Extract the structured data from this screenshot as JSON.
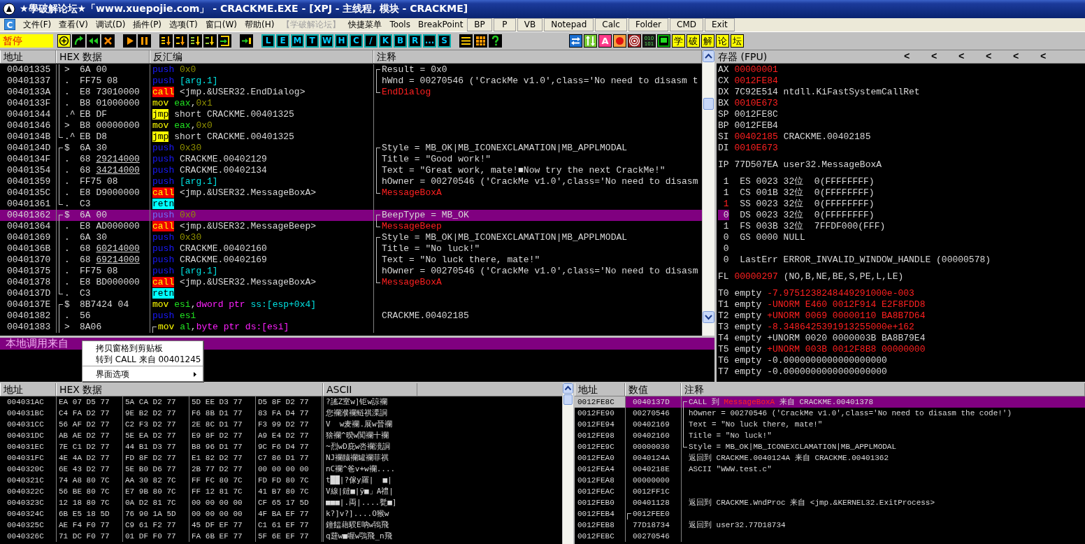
{
  "window": {
    "title": "★學破解论坛★「www.xuepojie.com」 - CRACKME.EXE - [XPJ - 主线程, 模块 - CRACKME]"
  },
  "menu_logo": "C",
  "menu": [
    {
      "label": "文件(F)",
      "kind": "menu",
      "disabled": false
    },
    {
      "label": "查看(V)",
      "kind": "menu",
      "disabled": false
    },
    {
      "label": "调试(D)",
      "kind": "menu",
      "disabled": false
    },
    {
      "label": "插件(P)",
      "kind": "menu",
      "disabled": false
    },
    {
      "label": "选项(T)",
      "kind": "menu",
      "disabled": false
    },
    {
      "label": "窗口(W)",
      "kind": "menu",
      "disabled": false
    },
    {
      "label": "帮助(H)",
      "kind": "menu",
      "disabled": false
    },
    {
      "label": "【学破解论坛】",
      "kind": "menu",
      "disabled": true
    },
    {
      "label": "快捷菜单",
      "kind": "menu",
      "disabled": false
    },
    {
      "label": "Tools",
      "kind": "menu",
      "disabled": false
    },
    {
      "label": "BreakPoint",
      "kind": "menu",
      "disabled": false
    },
    {
      "label": "BP",
      "kind": "button",
      "disabled": false
    },
    {
      "label": "P",
      "kind": "button",
      "disabled": false
    },
    {
      "label": "VB",
      "kind": "button",
      "disabled": false
    },
    {
      "label": "Notepad",
      "kind": "button",
      "disabled": false
    },
    {
      "label": "Calc",
      "kind": "button",
      "disabled": false
    },
    {
      "label": "Folder",
      "kind": "button",
      "disabled": false
    },
    {
      "label": "CMD",
      "kind": "button",
      "disabled": false
    },
    {
      "label": "Exit",
      "kind": "button",
      "disabled": false
    }
  ],
  "toolbar": {
    "status": "暂停",
    "groups": [
      {
        "items": [
          {
            "kind": "icon"
          },
          {
            "kind": "icon"
          },
          {
            "kind": "icon"
          },
          {
            "kind": "icon"
          }
        ]
      },
      {
        "items": [
          {
            "kind": "icon"
          },
          {
            "kind": "icon"
          }
        ]
      },
      {
        "items": [
          {
            "kind": "icon"
          },
          {
            "kind": "icon"
          },
          {
            "kind": "icon"
          },
          {
            "kind": "icon"
          },
          {
            "kind": "icon"
          }
        ]
      },
      {
        "items": [
          {
            "kind": "icon"
          }
        ]
      },
      {
        "items": [
          {
            "kind": "letter",
            "label": "L"
          },
          {
            "kind": "letter",
            "label": "E"
          },
          {
            "kind": "letter",
            "label": "M"
          },
          {
            "kind": "letter",
            "label": "T"
          },
          {
            "kind": "letter",
            "label": "W"
          },
          {
            "kind": "letter",
            "label": "H"
          },
          {
            "kind": "letter",
            "label": "C"
          },
          {
            "kind": "letter",
            "label": "/"
          },
          {
            "kind": "letter",
            "label": "K"
          },
          {
            "kind": "letter",
            "label": "B"
          },
          {
            "kind": "letter",
            "label": "R"
          },
          {
            "kind": "letter",
            "label": "..."
          },
          {
            "kind": "letter",
            "label": "S"
          }
        ]
      },
      {
        "items": [
          {
            "kind": "icon"
          },
          {
            "kind": "icon"
          },
          {
            "kind": "icon"
          }
        ]
      },
      {
        "items": [
          {
            "kind": "icon"
          },
          {
            "kind": "icon"
          },
          {
            "kind": "badge",
            "label": "A"
          },
          {
            "kind": "icon"
          },
          {
            "kind": "icon"
          },
          {
            "kind": "digits",
            "label": "010 101"
          },
          {
            "kind": "icon"
          },
          {
            "kind": "han",
            "label": "学"
          },
          {
            "kind": "han",
            "label": "破"
          },
          {
            "kind": "han",
            "label": "解"
          },
          {
            "kind": "han",
            "label": "论"
          },
          {
            "kind": "han",
            "label": "坛"
          }
        ]
      }
    ]
  },
  "disasm": {
    "columns": [
      "地址",
      "HEX 数据",
      "反汇编",
      "注释"
    ],
    "rows": [
      {
        "address": "00401335",
        "bracket": {
          "kind": "mid"
        },
        "mark": ">",
        "hex": "6A 00",
        "instruction": [
          {
            "text": "push ",
            "kind": "push"
          },
          {
            "text": "0x0",
            "kind": "imm"
          }
        ],
        "comment_bracket": {
          "kind": "top"
        },
        "comment": [
          {
            "text": "Result = 0x0",
            "kind": "plain"
          }
        ],
        "selected": false
      },
      {
        "address": "00401337",
        "bracket": {
          "kind": "mid"
        },
        "mark": ".",
        "hex": "FF75 08",
        "instruction": [
          {
            "text": "push ",
            "kind": "push"
          },
          {
            "text": "[arg.1]",
            "kind": "arg"
          }
        ],
        "comment_bracket": {
          "kind": "mid"
        },
        "comment": [
          {
            "text": "hWnd = 00270546 ('CrackMe v1.0',class='No need to disasm t",
            "kind": "plain"
          }
        ],
        "selected": false
      },
      {
        "address": "0040133A",
        "bracket": {
          "kind": "mid"
        },
        "mark": ".",
        "hex": "E8 73010000",
        "instruction": [
          {
            "text": "call",
            "kind": "call"
          },
          {
            "text": " <jmp.&USER32.EndDialog>",
            "kind": "plain"
          }
        ],
        "comment_bracket": {
          "kind": "bottom"
        },
        "comment": [
          {
            "text": "EndDialog",
            "kind": "api"
          }
        ],
        "selected": false
      },
      {
        "address": "0040133F",
        "bracket": {
          "kind": "mid"
        },
        "mark": ".",
        "hex": "B8 01000000",
        "instruction": [
          {
            "text": "mov ",
            "kind": "mov"
          },
          {
            "text": "eax",
            "kind": "reg"
          },
          {
            "text": ",",
            "kind": "plain"
          },
          {
            "text": "0x1",
            "kind": "imm"
          }
        ],
        "selected": false
      },
      {
        "address": "00401344",
        "bracket": {
          "kind": "mid"
        },
        "mark": ".^",
        "hex": "EB DF",
        "instruction": [
          {
            "text": "jmp",
            "kind": "jmp"
          },
          {
            "text": " short CRACKME.00401325",
            "kind": "plain"
          }
        ],
        "selected": false
      },
      {
        "address": "00401346",
        "bracket": {
          "kind": "mid"
        },
        "mark": ">",
        "hex": "B8 00000000",
        "instruction": [
          {
            "text": "mov ",
            "kind": "mov"
          },
          {
            "text": "eax",
            "kind": "reg"
          },
          {
            "text": ",",
            "kind": "plain"
          },
          {
            "text": "0x0",
            "kind": "imm"
          }
        ],
        "selected": false
      },
      {
        "address": "0040134B",
        "bracket": {
          "kind": "bottom"
        },
        "mark": ".^",
        "hex": "EB D8",
        "instruction": [
          {
            "text": "jmp",
            "kind": "jmp"
          },
          {
            "text": " short CRACKME.00401325",
            "kind": "plain"
          }
        ],
        "selected": false
      },
      {
        "address": "0040134D",
        "bracket": {
          "kind": "top"
        },
        "mark": "$",
        "hex": "6A 30",
        "instruction": [
          {
            "text": "push ",
            "kind": "push"
          },
          {
            "text": "0x30",
            "kind": "imm"
          }
        ],
        "comment_bracket": {
          "kind": "top"
        },
        "comment": [
          {
            "text": "Style = MB_OK|MB_ICONEXCLAMATION|MB_APPLMODAL",
            "kind": "plain"
          }
        ],
        "selected": false
      },
      {
        "address": "0040134F",
        "bracket": {
          "kind": "mid"
        },
        "mark": ".",
        "hex": "68",
        "hex_ref": "29214000",
        "instruction": [
          {
            "text": "push ",
            "kind": "push"
          },
          {
            "text": "CRACKME.00402129",
            "kind": "plain"
          }
        ],
        "comment_bracket": {
          "kind": "mid"
        },
        "comment": [
          {
            "text": "Title = \"Good work!\"",
            "kind": "plain"
          }
        ],
        "selected": false
      },
      {
        "address": "00401354",
        "bracket": {
          "kind": "mid"
        },
        "mark": ".",
        "hex": "68",
        "hex_ref": "34214000",
        "instruction": [
          {
            "text": "push ",
            "kind": "push"
          },
          {
            "text": "CRACKME.00402134",
            "kind": "plain"
          }
        ],
        "comment_bracket": {
          "kind": "mid"
        },
        "comment": [
          {
            "text": "Text = \"Great work, mate!■Now try the next CrackMe!\"",
            "kind": "plain"
          }
        ],
        "selected": false
      },
      {
        "address": "00401359",
        "bracket": {
          "kind": "mid"
        },
        "mark": ".",
        "hex": "FF75 08",
        "instruction": [
          {
            "text": "push ",
            "kind": "push"
          },
          {
            "text": "[arg.1]",
            "kind": "arg"
          }
        ],
        "comment_bracket": {
          "kind": "mid"
        },
        "comment": [
          {
            "text": "hOwner = 00270546 ('CrackMe v1.0',class='No need to disasm",
            "kind": "plain"
          }
        ],
        "selected": false
      },
      {
        "address": "0040135C",
        "bracket": {
          "kind": "mid"
        },
        "mark": ".",
        "hex": "E8 D9000000",
        "instruction": [
          {
            "text": "call",
            "kind": "call"
          },
          {
            "text": " <jmp.&USER32.MessageBoxA>",
            "kind": "plain"
          }
        ],
        "comment_bracket": {
          "kind": "bottom"
        },
        "comment": [
          {
            "text": "MessageBoxA",
            "kind": "api"
          }
        ],
        "selected": false
      },
      {
        "address": "00401361",
        "bracket": {
          "kind": "bottom"
        },
        "mark": ".",
        "hex": "C3",
        "instruction": [
          {
            "text": "retn",
            "kind": "retn"
          }
        ],
        "selected": false
      },
      {
        "address": "00401362",
        "bracket": {
          "kind": "top"
        },
        "mark": "$",
        "hex": "6A 00",
        "instruction": [
          {
            "text": "push ",
            "kind": "push"
          },
          {
            "text": "0x0",
            "kind": "imm"
          }
        ],
        "comment_bracket": {
          "kind": "top"
        },
        "comment": [
          {
            "text": "BeepType = MB_OK",
            "kind": "plain"
          }
        ],
        "selected": true
      },
      {
        "address": "00401364",
        "bracket": {
          "kind": "mid"
        },
        "mark": ".",
        "hex": "E8 AD000000",
        "instruction": [
          {
            "text": "call",
            "kind": "call"
          },
          {
            "text": " <jmp.&USER32.MessageBeep>",
            "kind": "plain"
          }
        ],
        "comment_bracket": {
          "kind": "bottom"
        },
        "comment": [
          {
            "text": "MessageBeep",
            "kind": "api"
          }
        ],
        "selected": false
      },
      {
        "address": "00401369",
        "bracket": {
          "kind": "mid"
        },
        "mark": ".",
        "hex": "6A 30",
        "instruction": [
          {
            "text": "push ",
            "kind": "push"
          },
          {
            "text": "0x30",
            "kind": "imm"
          }
        ],
        "comment_bracket": {
          "kind": "top"
        },
        "comment": [
          {
            "text": "Style = MB_OK|MB_ICONEXCLAMATION|MB_APPLMODAL",
            "kind": "plain"
          }
        ],
        "selected": false
      },
      {
        "address": "0040136B",
        "bracket": {
          "kind": "mid"
        },
        "mark": ".",
        "hex": "68",
        "hex_ref": "60214000",
        "instruction": [
          {
            "text": "push ",
            "kind": "push"
          },
          {
            "text": "CRACKME.00402160",
            "kind": "plain"
          }
        ],
        "comment_bracket": {
          "kind": "mid"
        },
        "comment": [
          {
            "text": "Title = \"No luck!\"",
            "kind": "plain"
          }
        ],
        "selected": false
      },
      {
        "address": "00401370",
        "bracket": {
          "kind": "mid"
        },
        "mark": ".",
        "hex": "68",
        "hex_ref": "69214000",
        "instruction": [
          {
            "text": "push ",
            "kind": "push"
          },
          {
            "text": "CRACKME.00402169",
            "kind": "plain"
          }
        ],
        "comment_bracket": {
          "kind": "mid"
        },
        "comment": [
          {
            "text": "Text = \"No luck there, mate!\"",
            "kind": "plain"
          }
        ],
        "selected": false
      },
      {
        "address": "00401375",
        "bracket": {
          "kind": "mid"
        },
        "mark": ".",
        "hex": "FF75 08",
        "instruction": [
          {
            "text": "push ",
            "kind": "push"
          },
          {
            "text": "[arg.1]",
            "kind": "arg"
          }
        ],
        "comment_bracket": {
          "kind": "mid"
        },
        "comment": [
          {
            "text": "hOwner = 00270546 ('CrackMe v1.0',class='No need to disasm",
            "kind": "plain"
          }
        ],
        "selected": false
      },
      {
        "address": "00401378",
        "bracket": {
          "kind": "mid"
        },
        "mark": ".",
        "hex": "E8 BD000000",
        "instruction": [
          {
            "text": "call",
            "kind": "call"
          },
          {
            "text": " <jmp.&USER32.MessageBoxA>",
            "kind": "plain"
          }
        ],
        "comment_bracket": {
          "kind": "bottom"
        },
        "comment": [
          {
            "text": "MessageBoxA",
            "kind": "api"
          }
        ],
        "selected": false
      },
      {
        "address": "0040137D",
        "bracket": {
          "kind": "bottom"
        },
        "mark": ".",
        "hex": "C3",
        "instruction": [
          {
            "text": "retn",
            "kind": "retn"
          }
        ],
        "selected": false
      },
      {
        "address": "0040137E",
        "bracket": {
          "kind": "top"
        },
        "mark": "$",
        "hex": "8B7424 04",
        "instruction": [
          {
            "text": "mov ",
            "kind": "mov"
          },
          {
            "text": "esi",
            "kind": "reg"
          },
          {
            "text": ",",
            "kind": "plain"
          },
          {
            "text": "dword ptr ",
            "kind": "ptr"
          },
          {
            "text": "ss:[esp+0x4]",
            "kind": "mem"
          }
        ],
        "selected": false
      },
      {
        "address": "00401382",
        "bracket": {
          "kind": "mid"
        },
        "mark": ".",
        "hex": "56",
        "instruction": [
          {
            "text": "push ",
            "kind": "push"
          },
          {
            "text": "esi",
            "kind": "reg"
          }
        ],
        "comment": [
          {
            "text": "CRACKME.00402185",
            "kind": "plain"
          }
        ],
        "selected": false
      },
      {
        "address": "00401383",
        "bracket": {
          "kind": "mid"
        },
        "mark": ">",
        "hex": "8A06",
        "instruction_bracket": {
          "kind": "top"
        },
        "instruction": [
          {
            "text": "mov ",
            "kind": "mov"
          },
          {
            "text": "al",
            "kind": "reg"
          },
          {
            "text": ",",
            "kind": "plain"
          },
          {
            "text": "byte ptr ds:[esi]",
            "kind": "ptr"
          }
        ],
        "selected": false
      }
    ]
  },
  "info": {
    "text": "本地调用来自"
  },
  "context_menu": [
    {
      "label": "拷贝窗格到剪贴板",
      "submenu": false,
      "separator_after": false
    },
    {
      "label": "转到 CALL 来自 00401245",
      "submenu": false,
      "separator_after": true
    },
    {
      "label": "界面选项",
      "submenu": true,
      "separator_after": false
    }
  ],
  "registers": {
    "title": "存器 (FPU)",
    "arrows": [
      "<",
      "<",
      "<",
      "<",
      "<",
      "<"
    ],
    "groups": [
      [
        [
          {
            "text": "AX ",
            "kind": "plain"
          },
          {
            "text": "00000001",
            "kind": "changed"
          }
        ],
        [
          {
            "text": "CX ",
            "kind": "plain"
          },
          {
            "text": "0012FE84",
            "kind": "changed"
          }
        ],
        [
          {
            "text": "DX 7C92E514 ntdll.KiFastSystemCallRet",
            "kind": "plain"
          }
        ],
        [
          {
            "text": "BX ",
            "kind": "plain"
          },
          {
            "text": "0010E673",
            "kind": "changed"
          }
        ],
        [
          {
            "text": "SP 0012FE8C",
            "kind": "plain"
          }
        ],
        [
          {
            "text": "BP 0012FEB4",
            "kind": "plain"
          }
        ],
        [
          {
            "text": "SI ",
            "kind": "plain"
          },
          {
            "text": "00402185",
            "kind": "changed"
          },
          {
            "text": " CRACKME.00402185",
            "kind": "plain"
          }
        ],
        [
          {
            "text": "DI ",
            "kind": "plain"
          },
          {
            "text": "0010E673",
            "kind": "changed"
          }
        ]
      ],
      [
        [
          {
            "text": "IP 77D507EA user32.MessageBoxA",
            "kind": "plain"
          }
        ]
      ],
      [
        [
          {
            "text": " 1",
            "kind": "plain"
          },
          {
            "text": "  ES 0023 32位  0(FFFFFFFF)",
            "kind": "plain"
          }
        ],
        [
          {
            "text": " 1",
            "kind": "plain"
          },
          {
            "text": "  CS 001B 32位  0(FFFFFFFF)",
            "kind": "plain"
          }
        ],
        [
          {
            "text": " 1",
            "kind": "changed"
          },
          {
            "text": "  SS 0023 32位  0(FFFFFFFF)",
            "kind": "plain"
          }
        ],
        [
          {
            "text": " 0",
            "kind": "selected"
          },
          {
            "text": "  DS 0023 32位  0(FFFFFFFF)",
            "kind": "plain"
          }
        ],
        [
          {
            "text": " 1",
            "kind": "plain"
          },
          {
            "text": "  FS 003B 32位  7FFDF000(FFF)",
            "kind": "plain"
          }
        ],
        [
          {
            "text": " 0",
            "kind": "plain"
          },
          {
            "text": "  GS 0000 NULL",
            "kind": "plain"
          }
        ],
        [
          {
            "text": " 0",
            "kind": "plain"
          }
        ],
        [
          {
            "text": " 0",
            "kind": "plain"
          },
          {
            "text": "  LastErr ERROR_INVALID_WINDOW_HANDLE (00000578)",
            "kind": "plain"
          }
        ]
      ],
      [
        [
          {
            "text": "FL ",
            "kind": "plain"
          },
          {
            "text": "00000297",
            "kind": "changed"
          },
          {
            "text": " (NO,B,NE,BE,S,PE,L,LE)",
            "kind": "plain"
          }
        ]
      ],
      [
        [
          {
            "text": "T0 empty ",
            "kind": "plain"
          },
          {
            "text": "-7.9751238248449291000e-003",
            "kind": "changed"
          }
        ],
        [
          {
            "text": "T1 empty ",
            "kind": "plain"
          },
          {
            "text": "-UNORM E460 0012F914 E2F8FDD8",
            "kind": "changed"
          }
        ],
        [
          {
            "text": "T2 empty ",
            "kind": "plain"
          },
          {
            "text": "+UNORM 0069 00000110 BA8B7D64",
            "kind": "changed"
          }
        ],
        [
          {
            "text": "T3 empty ",
            "kind": "plain"
          },
          {
            "text": "-8.3486425391913255000e+162",
            "kind": "changed"
          }
        ],
        [
          {
            "text": "T4 empty +UNORM 0020 0000003B BA8B79E4",
            "kind": "plain"
          }
        ],
        [
          {
            "text": "T5 empty ",
            "kind": "plain"
          },
          {
            "text": "+UNORM 003B 0012F8B8 00000000",
            "kind": "changed"
          }
        ],
        [
          {
            "text": "T6 empty -0.0000000000000000000",
            "kind": "plain"
          }
        ],
        [
          {
            "text": "T7 empty -0.0000000000000000000",
            "kind": "plain"
          }
        ]
      ]
    ]
  },
  "dump": {
    "columns": [
      "地址",
      "HEX 数据",
      "ASCII"
    ],
    "rows": [
      {
        "address": "004031AC",
        "hex": [
          "EA 07 D5 77",
          "5A CA D2 77",
          "5D EE D3 77",
          "D5 8F D2 77"
        ],
        "ascii": "?謠Z室w]钜w諒襴"
      },
      {
        "address": "004031BC",
        "hex": [
          "C4 FA D2 77",
          "9E B2 D2 77",
          "F6 8B D1 77",
          "83 FA D4 77"
        ],
        "ascii": "您襴濮襴鲢祺溧詷"
      },
      {
        "address": "004031CC",
        "hex": [
          "56 AF D2 77",
          "C2 F3 D2 77",
          "2E 8C D1 77",
          "F3 99 D2 77"
        ],
        "ascii": "V  w麦襴.展w晉襴"
      },
      {
        "address": "004031DC",
        "hex": [
          "AB AE D2 77",
          "5E EA D2 77",
          "E9 8F D2 77",
          "A9 E4 D2 77"
        ],
        "ascii": "猞襴^暌w闃襴十襴"
      },
      {
        "address": "004031EC",
        "hex": [
          "7E C1 D2 77",
          "44 B1 D3 77",
          "B8 96 D1 77",
          "9C F6 D4 77"
        ],
        "ascii": "~烈wD庇w呇襴滰詷"
      },
      {
        "address": "004031FC",
        "hex": [
          "4E 4A D2 77",
          "FD 8F D2 77",
          "E1 82 D2 77",
          "C7 86 D1 77"
        ],
        "ascii": "NJ襴齉襴罐襴菲祺"
      },
      {
        "address": "0040320C",
        "hex": [
          "6E 43 D2 77",
          "5E B0 D6 77",
          "2B 77 D2 77",
          "00 00 00 00"
        ],
        "ascii": "nC襴^爸v+w襴...."
      },
      {
        "address": "0040321C",
        "hex": [
          "74 A8 80 7C",
          "AA 30 82 7C",
          "FF FC 80 7C",
          "FD FD 80 7C"
        ],
        "ascii": "t██|?傢y羅|  ■|"
      },
      {
        "address": "0040322C",
        "hex": [
          "56 BE 80 7C",
          "E7 9B 80 7C",
          "FF 12 81 7C",
          "41 B7 80 7C"
        ],
        "ascii": "V線|鐽■|ÿ■」A禮|"
      },
      {
        "address": "0040323C",
        "hex": [
          "12 18 80 7C",
          "0A D2 81 7C",
          "00 00 00 00",
          "CF 65 17 5D"
        ],
        "ascii": "■■■|.両|....甏■]"
      },
      {
        "address": "0040324C",
        "hex": [
          "6B E5 18 5D",
          "76 90 1A 5D",
          "00 00 00 00",
          "4F BA EF 77"
        ],
        "ascii": "k?]v?]....O猴w"
      },
      {
        "address": "0040325C",
        "hex": [
          "AE F4 F0 77",
          "C9 61 F2 77",
          "45 DF EF 77",
          "C1 61 EF 77"
        ],
        "ascii": "鐘饂藉騤E呐w鴇飛"
      },
      {
        "address": "0040326C",
        "hex": [
          "71 DC F0 77",
          "01 DF F0 77",
          "FA 6B EF 77",
          "5F 6E EF 77"
        ],
        "ascii": "q莛w■喔w鶚飛_n飛"
      }
    ]
  },
  "stack": {
    "columns": [
      "地址",
      "数值",
      "注释"
    ],
    "rows": [
      {
        "address": "0012FE8C",
        "value": "0040137D",
        "comment_bracket": {
          "kind": "top"
        },
        "comment": [
          {
            "text": "CALL 到 ",
            "kind": "plain"
          },
          {
            "text": "MessageBoxA",
            "kind": "api"
          },
          {
            "text": " 来自 CRACKME.00401378",
            "kind": "plain"
          }
        ],
        "selected": true
      },
      {
        "address": "0012FE90",
        "value": "00270546",
        "comment_bracket": {
          "kind": "mid"
        },
        "comment": [
          {
            "text": "hOwner = 00270546 ('CrackMe v1.0',class='No need to disasm the code!')",
            "kind": "plain"
          }
        ],
        "selected": false
      },
      {
        "address": "0012FE94",
        "value": "00402169",
        "comment_bracket": {
          "kind": "mid"
        },
        "comment": [
          {
            "text": "Text = \"No luck there, mate!\"",
            "kind": "plain"
          }
        ],
        "selected": false
      },
      {
        "address": "0012FE98",
        "value": "00402160",
        "comment_bracket": {
          "kind": "mid"
        },
        "comment": [
          {
            "text": "Title = \"No luck!\"",
            "kind": "plain"
          }
        ],
        "selected": false
      },
      {
        "address": "0012FE9C",
        "value": "00000030",
        "comment_bracket": {
          "kind": "bottom"
        },
        "comment": [
          {
            "text": "Style = MB_OK|MB_ICONEXCLAMATION|MB_APPLMODAL",
            "kind": "plain"
          }
        ],
        "selected": false
      },
      {
        "address": "0012FEA0",
        "value": "0040124A",
        "comment": [
          {
            "text": "返回到 CRACKME.0040124A 来自 CRACKME.00401362",
            "kind": "plain"
          }
        ],
        "selected": false
      },
      {
        "address": "0012FEA4",
        "value": "0040218E",
        "comment": [
          {
            "text": "ASCII \"WWW.test.c\"",
            "kind": "plain"
          }
        ],
        "selected": false
      },
      {
        "address": "0012FEA8",
        "value": "00000000",
        "selected": false
      },
      {
        "address": "0012FEAC",
        "value": "0012FF1C",
        "selected": false
      },
      {
        "address": "0012FEB0",
        "value": "00401128",
        "comment": [
          {
            "text": "返回到 CRACKME.WndProc 来自 <jmp.&KERNEL32.ExitProcess>",
            "kind": "plain"
          }
        ],
        "selected": false
      },
      {
        "address": "0012FEB4",
        "value": "0012FEE0",
        "value_bracket": {
          "kind": "top"
        },
        "selected": false
      },
      {
        "address": "0012FEB8",
        "value": "77D18734",
        "comment": [
          {
            "text": "返回到 user32.77D18734",
            "kind": "plain"
          }
        ],
        "selected": false
      },
      {
        "address": "0012FEBC",
        "value": "00270546",
        "selected": false
      }
    ]
  }
}
